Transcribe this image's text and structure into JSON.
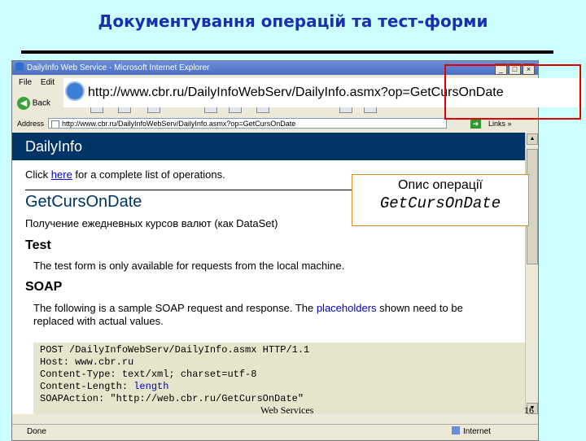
{
  "slide": {
    "title": "Документування операцій та тест-форми",
    "footer": "Web Services",
    "page_number": "16"
  },
  "browser": {
    "window_title": "DailyInfo Web Service - Microsoft Internet Explorer",
    "window_controls": [
      "_",
      "□",
      "×"
    ],
    "menu": [
      "File",
      "Edit"
    ],
    "back_label": "Back",
    "address_label": "Address",
    "address_url": "http://www.cbr.ru/DailyInfoWebServ/DailyInfo.asmx?op=GetCursOnDate",
    "zoomed_url": "http://www.cbr.ru/DailyInfoWebServ/DailyInfo.asmx?op=GetCursOnDate",
    "go_label": "Go",
    "links_label": "Links »",
    "status_left": "Done",
    "status_zone": "Internet"
  },
  "page": {
    "banner": "DailyInfo",
    "click_prefix": "Click ",
    "click_link": "here",
    "click_suffix": " for a complete list of operations.",
    "operation_name": "GetCursOnDate",
    "operation_description": "Получение ежедневных курсов валют (как DataSet)",
    "test_heading": "Test",
    "test_text": "The test form is only available for requests from the local machine.",
    "soap_heading": "SOAP",
    "soap_text_1a": "The following is a sample SOAP request and response. The ",
    "soap_placeholders": "placeholders",
    "soap_text_1b": " shown need to be",
    "soap_text_2": "replaced with actual values.",
    "code_lines": [
      "POST /DailyInfoWebServ/DailyInfo.asmx HTTP/1.1",
      "Host: www.cbr.ru",
      "Content-Type: text/xml; charset=utf-8",
      "Content-Length: ",
      "SOAPAction: \"http://web.cbr.ru/GetCursOnDate\""
    ],
    "code_length_placeholder": "length"
  },
  "callout": {
    "line1": "Опис операції",
    "line2": "GetCursOnDate"
  },
  "colors": {
    "slide_background": "#ccffff",
    "title": "#1a2fb0",
    "banner": "#003366",
    "highlight": "#e00000"
  }
}
